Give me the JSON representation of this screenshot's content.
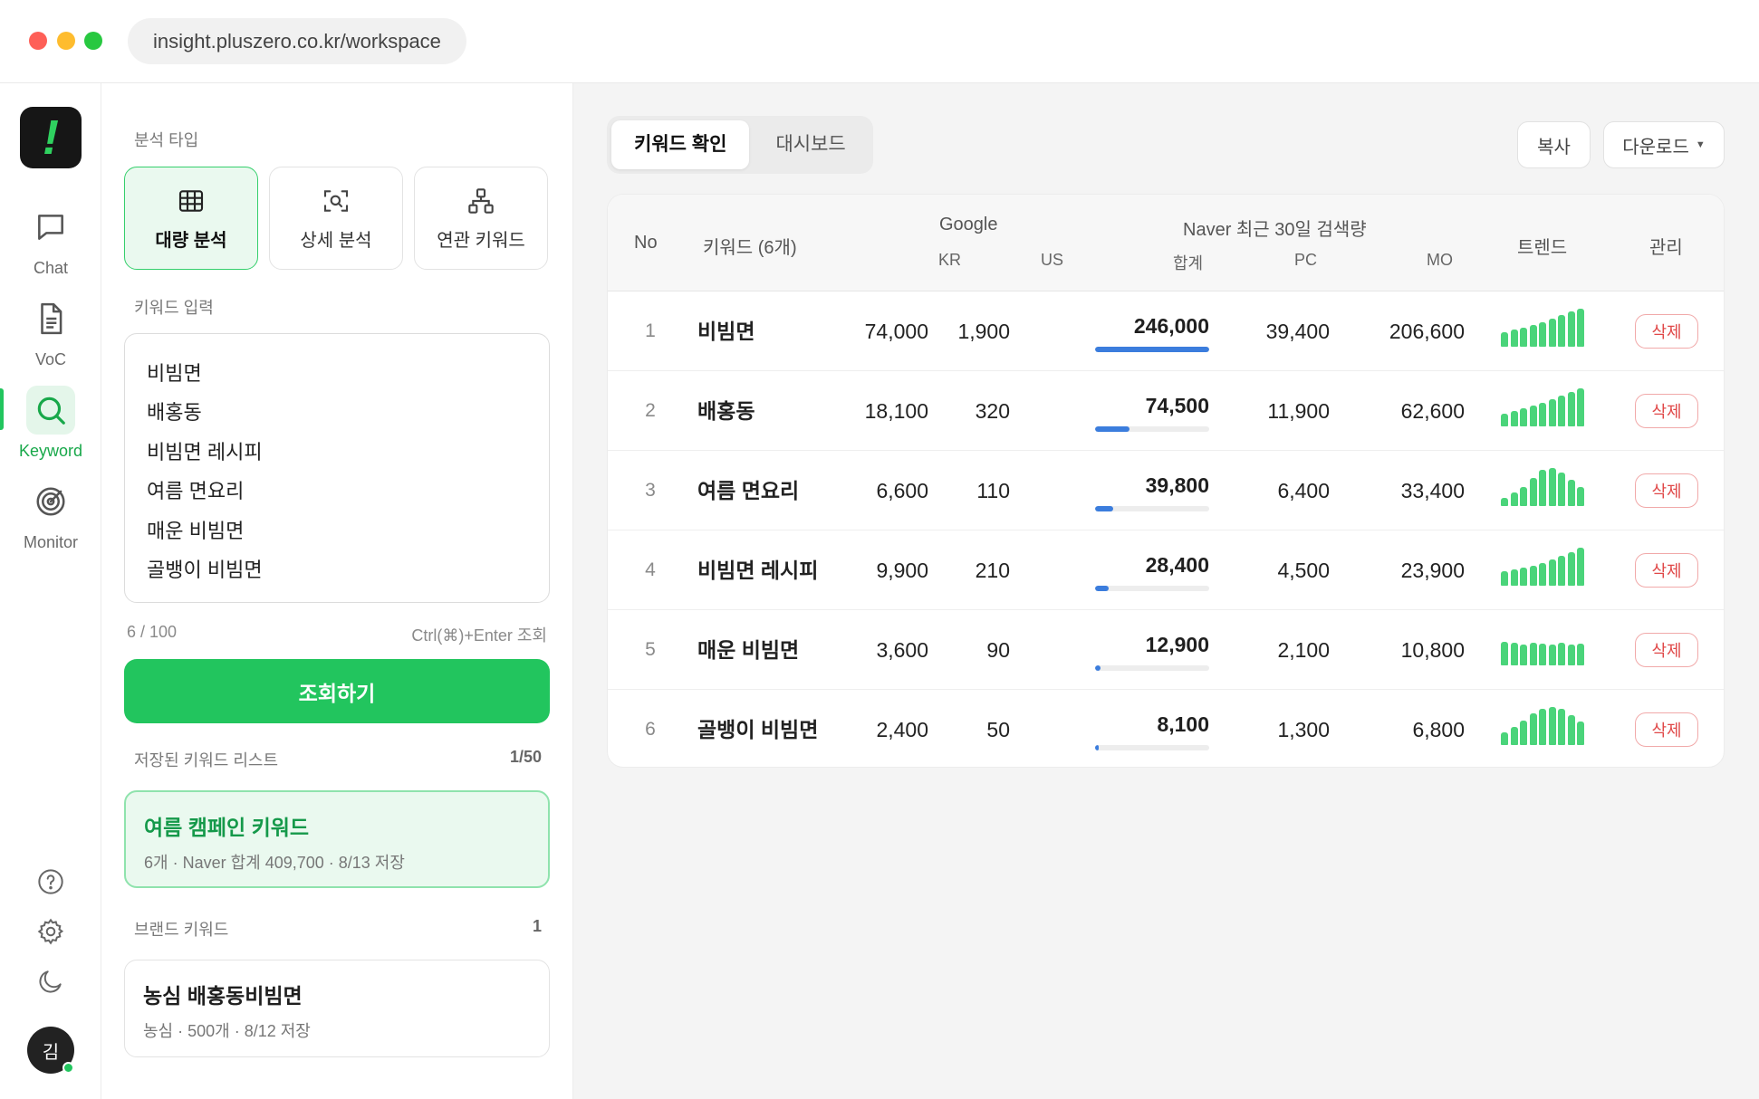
{
  "browser": {
    "url": "insight.pluszero.co.kr/workspace"
  },
  "logo": {
    "glyph": "!"
  },
  "rail": {
    "items": [
      {
        "label": "Chat",
        "icon": "chat-icon"
      },
      {
        "label": "VoC",
        "icon": "document-icon"
      },
      {
        "label": "Keyword",
        "icon": "search-icon",
        "active": true
      },
      {
        "label": "Monitor",
        "icon": "radar-icon"
      }
    ],
    "bottom": [
      "help-icon",
      "gear-icon",
      "moon-icon"
    ],
    "avatar": "김"
  },
  "panel": {
    "analysis_type_label": "분석 타입",
    "types": [
      {
        "label": "대량 분석",
        "icon": "table-icon",
        "active": true
      },
      {
        "label": "상세 분석",
        "icon": "scan-search-icon",
        "active": false
      },
      {
        "label": "연관 키워드",
        "icon": "hierarchy-icon",
        "active": false
      }
    ],
    "keyword_input_label": "키워드 입력",
    "keywords": [
      "비빔면",
      "배홍동",
      "비빔면 레시피",
      "여름 면요리",
      "매운 비빔면",
      "골뱅이 비빔면"
    ],
    "count": "6 / 100",
    "shortcut_hint": "Ctrl(⌘)+Enter 조회",
    "query_button": "조회하기",
    "saved": {
      "label": "저장된 키워드 리스트",
      "count": "1/50",
      "title": "여름 캠페인 키워드",
      "sub": "6개 · Naver 합계 409,700 · 8/13 저장"
    },
    "brand": {
      "label": "브랜드 키워드",
      "count": "1",
      "title": "농심 배홍동비빔면",
      "sub": "농심 · 500개 · 8/12 저장"
    }
  },
  "main": {
    "tabs": [
      {
        "label": "키워드 확인",
        "active": true
      },
      {
        "label": "대시보드",
        "active": false
      }
    ],
    "copy_button": "복사",
    "download_button": "다운로드",
    "table": {
      "headers": {
        "no": "No",
        "keyword": "키워드 (6개)",
        "google": "Google",
        "kr": "KR",
        "us": "US",
        "naver": "Naver 최근 30일 검색량",
        "sum": "합계",
        "pc": "PC",
        "mo": "MO",
        "trend": "트렌드",
        "manage": "관리"
      },
      "delete_label": "삭제",
      "bar_color": "#3b7ddd",
      "trend_color": "#4ad47a",
      "rows": [
        {
          "no": "1",
          "keyword": "비빔면",
          "kr": "74,000",
          "us": "1,900",
          "sum": "246,000",
          "sum_ratio": 1.0,
          "pc": "39,400",
          "mo": "206,600",
          "trend": [
            16,
            19,
            21,
            24,
            27,
            31,
            35,
            39,
            42
          ]
        },
        {
          "no": "2",
          "keyword": "배홍동",
          "kr": "18,100",
          "us": "320",
          "sum": "74,500",
          "sum_ratio": 0.3,
          "pc": "11,900",
          "mo": "62,600",
          "trend": [
            14,
            17,
            20,
            23,
            26,
            30,
            34,
            38,
            42
          ]
        },
        {
          "no": "3",
          "keyword": "여름 면요리",
          "kr": "6,600",
          "us": "110",
          "sum": "39,800",
          "sum_ratio": 0.16,
          "pc": "6,400",
          "mo": "33,400",
          "trend": [
            9,
            15,
            21,
            31,
            40,
            42,
            37,
            29,
            21
          ]
        },
        {
          "no": "4",
          "keyword": "비빔면 레시피",
          "kr": "9,900",
          "us": "210",
          "sum": "28,400",
          "sum_ratio": 0.12,
          "pc": "4,500",
          "mo": "23,900",
          "trend": [
            16,
            18,
            20,
            22,
            25,
            29,
            33,
            37,
            42
          ]
        },
        {
          "no": "5",
          "keyword": "매운 비빔면",
          "kr": "3,600",
          "us": "90",
          "sum": "12,900",
          "sum_ratio": 0.05,
          "pc": "2,100",
          "mo": "10,800",
          "trend": [
            26,
            25,
            23,
            25,
            24,
            23,
            25,
            23,
            24
          ]
        },
        {
          "no": "6",
          "keyword": "골뱅이 비빔면",
          "kr": "2,400",
          "us": "50",
          "sum": "8,100",
          "sum_ratio": 0.03,
          "pc": "1,300",
          "mo": "6,800",
          "trend": [
            14,
            20,
            27,
            35,
            40,
            42,
            40,
            33,
            26
          ]
        }
      ]
    }
  }
}
